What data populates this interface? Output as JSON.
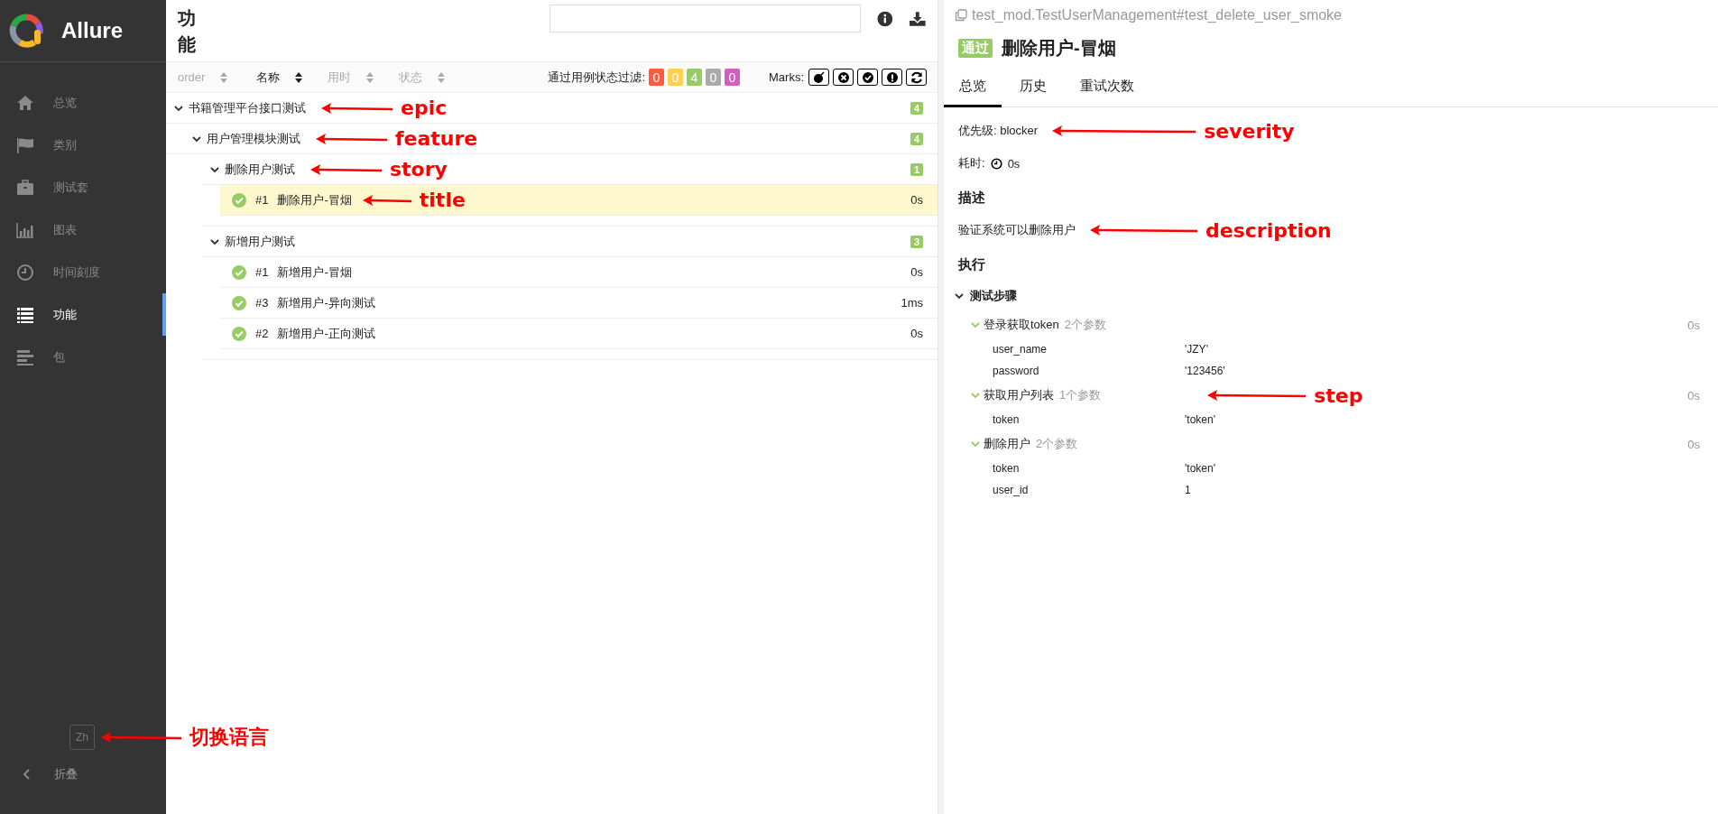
{
  "sidebar": {
    "brand": "Allure",
    "items": [
      {
        "label": "总览",
        "selected": false
      },
      {
        "label": "类别",
        "selected": false
      },
      {
        "label": "测试套",
        "selected": false
      },
      {
        "label": "图表",
        "selected": false
      },
      {
        "label": "时间刻度",
        "selected": false
      },
      {
        "label": "功能",
        "selected": true
      },
      {
        "label": "包",
        "selected": false
      }
    ],
    "language": {
      "label": "Zh",
      "annotation": "切换语言"
    },
    "collapse": "折叠"
  },
  "tree_panel": {
    "title": "功能",
    "sort_columns": [
      {
        "label": "order",
        "selected": false
      },
      {
        "label": "名称",
        "selected": true
      },
      {
        "label": "用时",
        "selected": false
      },
      {
        "label": "状态",
        "selected": false
      }
    ],
    "filter_label": "通过用例状态过滤:",
    "status_filters": [
      {
        "count": "0",
        "color": "#fd5a3e"
      },
      {
        "count": "0",
        "color": "#ffd050"
      },
      {
        "count": "4",
        "color": "#97cc64"
      },
      {
        "count": "0",
        "color": "#aaaaaa"
      },
      {
        "count": "0",
        "color": "#d35ebe"
      }
    ],
    "marks_label": "Marks:",
    "marks": [
      {
        "kind": "flaky"
      },
      {
        "kind": "failed"
      },
      {
        "kind": "passed"
      },
      {
        "kind": "broken"
      },
      {
        "kind": "retry"
      }
    ],
    "tree": [
      {
        "name": "书籍管理平台接口测试",
        "count": "4",
        "expanded": true,
        "annotation": "epic",
        "children": [
          {
            "name": "用户管理模块测试",
            "count": "4",
            "expanded": true,
            "annotation": "feature",
            "children": [
              {
                "name": "删除用户测试",
                "count": "1",
                "expanded": true,
                "annotation": "story",
                "tests": [
                  {
                    "order": "#1",
                    "name": "删除用户-冒烟",
                    "duration": "0s",
                    "kind": "passed",
                    "selected": true,
                    "annotation": "title"
                  }
                ]
              },
              {
                "name": "新增用户测试",
                "count": "3",
                "expanded": true,
                "tests": [
                  {
                    "order": "#1",
                    "name": "新增用户-冒烟",
                    "duration": "0s",
                    "kind": "passed",
                    "selected": false
                  },
                  {
                    "order": "#3",
                    "name": "新增用户-异向测试",
                    "duration": "1ms",
                    "kind": "passed",
                    "selected": false
                  },
                  {
                    "order": "#2",
                    "name": "新增用户-正向测试",
                    "duration": "0s",
                    "kind": "passed",
                    "selected": false
                  }
                ]
              }
            ]
          }
        ]
      }
    ]
  },
  "detail": {
    "full_name": "test_mod.TestUserManagement#test_delete_user_smoke",
    "status": {
      "label": "通过",
      "kind": "passed"
    },
    "title": "删除用户-冒烟",
    "tabs": [
      {
        "label": "总览",
        "selected": true
      },
      {
        "label": "历史",
        "selected": false
      },
      {
        "label": "重试次数",
        "selected": false
      }
    ],
    "severity": {
      "label": "优先级: blocker",
      "annotation": "severity"
    },
    "duration": {
      "label": "耗时:",
      "value": "0s"
    },
    "description_heading": "描述",
    "description": {
      "text": "验证系统可以删除用户",
      "annotation": "description"
    },
    "execution_heading": "执行",
    "steps_group": {
      "label": "测试步骤",
      "expanded": true
    },
    "steps": [
      {
        "name": "登录获取token",
        "params_count": "2个参数",
        "duration": "0s",
        "expanded": true,
        "params": [
          {
            "name": "user_name",
            "value": "'JZY'"
          },
          {
            "name": "password",
            "value": "'123456'"
          }
        ]
      },
      {
        "name": "获取用户列表",
        "params_count": "1个参数",
        "duration": "0s",
        "expanded": true,
        "annotation": "step",
        "params": [
          {
            "name": "token",
            "value": "'token'"
          }
        ]
      },
      {
        "name": "删除用户",
        "params_count": "2个参数",
        "duration": "0s",
        "expanded": true,
        "params": [
          {
            "name": "token",
            "value": "'token'"
          },
          {
            "name": "user_id",
            "value": "1"
          }
        ]
      }
    ]
  }
}
